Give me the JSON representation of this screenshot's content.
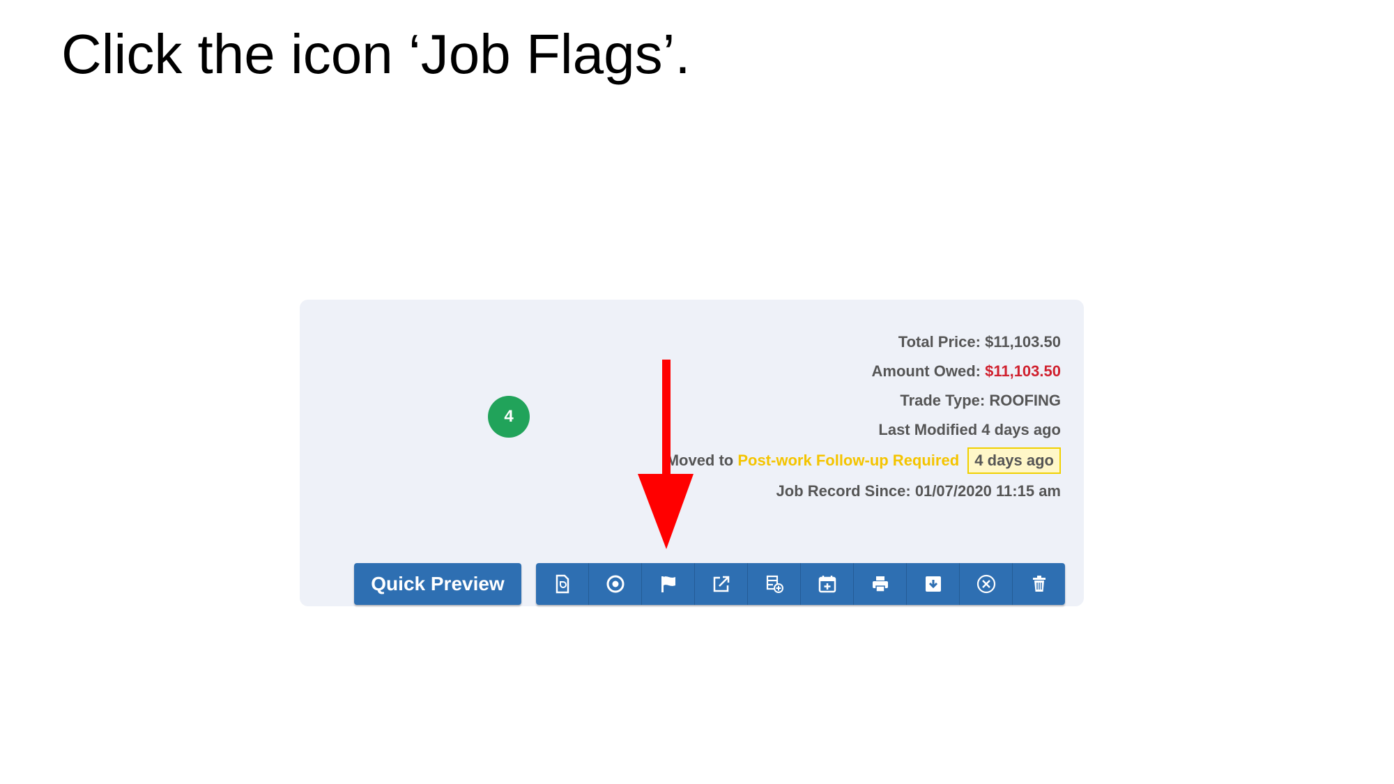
{
  "instruction": "Click the icon ‘Job Flags’.",
  "job": {
    "stage_count": "4",
    "total_price_label": "Total Price:",
    "total_price": "$11,103.50",
    "amount_owed_label": "Amount Owed:",
    "amount_owed": "$11,103.50",
    "trade_type_label": "Trade Type:",
    "trade_type": "ROOFING",
    "last_modified": "Last Modified 4 days ago",
    "moved_prefix": "Moved to",
    "moved_stage": "Post-work Follow-up Required",
    "moved_time": "4 days ago",
    "record_since": "Job Record Since: 01/07/2020 11:15 am"
  },
  "actions": {
    "quick_preview_label": "Quick Preview",
    "icons": [
      "document-icon",
      "circle-target-icon",
      "flag-icon",
      "external-link-icon",
      "table-add-icon",
      "calendar-add-icon",
      "print-icon",
      "archive-icon",
      "tools-icon",
      "trash-icon"
    ]
  },
  "colors": {
    "button_blue": "#2e6fb2",
    "badge_green": "#21a35a",
    "owed_red": "#d0202e",
    "stage_yellow": "#f4c400",
    "arrow_red": "#ff0000"
  }
}
